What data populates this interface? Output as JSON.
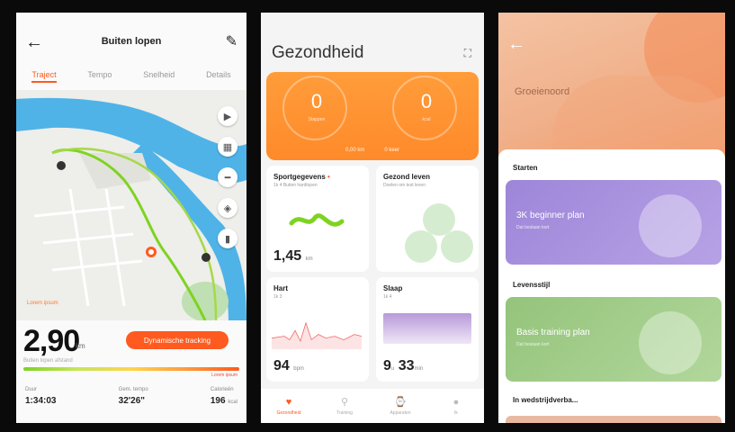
{
  "colors": {
    "accent": "#ff5a1f",
    "orange_card": "#ff8a2a",
    "route_green": "#7ed321",
    "water": "#4fb3e8",
    "plan_purple": "#a78bdb",
    "plan_green": "#9cc985"
  },
  "phone1": {
    "title": "Buiten lopen",
    "tabs": [
      "Traject",
      "Tempo",
      "Snelheid",
      "Details"
    ],
    "hint": "Lorem ipsum",
    "distance": "2,90",
    "distance_unit": "km",
    "distance_sub": "Buiten lopen afstand",
    "pill": "Dynamische tracking",
    "red_label": "Lorem ipsum",
    "stats": [
      {
        "label": "Duur",
        "value": "1:34:03"
      },
      {
        "label": "Gem. tempo",
        "value": "32'26\""
      },
      {
        "label": "Calorieën",
        "value": "196",
        "unit": "kcal"
      }
    ]
  },
  "phone2": {
    "title": "Gezondheid",
    "rings": [
      {
        "value": "0",
        "label": "Stappen"
      },
      {
        "value": "0",
        "label": "kcal"
      }
    ],
    "orange_footer": [
      "0,00 km",
      "0 keer"
    ],
    "cards": {
      "sport": {
        "title": "Sportgegevens",
        "sub": "1k 4 Buiten hardlopen",
        "value": "1,45",
        "unit": "km"
      },
      "healthy": {
        "title": "Gezond leven",
        "sub": "Doelen om test leven"
      },
      "heart": {
        "title": "Hart",
        "sub": "1k 3",
        "value": "94",
        "unit": "bpm"
      },
      "sleep": {
        "title": "Slaap",
        "sub": "1k 4",
        "hours": "9",
        "h_unit": "u",
        "minutes": "33",
        "m_unit": "min"
      }
    },
    "nav": [
      {
        "label": "Gezondheid",
        "icon": "heart-icon"
      },
      {
        "label": "Training",
        "icon": "run-icon"
      },
      {
        "label": "Apparaten",
        "icon": "watch-icon"
      },
      {
        "label": "Ik",
        "icon": "user-icon"
      }
    ]
  },
  "phone3": {
    "hero_title": "Groeienoord",
    "sections": [
      "Starten",
      "Levensstijl",
      "In wedstrijdverba..."
    ],
    "plans": [
      {
        "title": "3K beginner plan",
        "sub": "Dat beslaan kort"
      },
      {
        "title": "Basis training plan",
        "sub": "Dat beslaan kort"
      }
    ]
  }
}
